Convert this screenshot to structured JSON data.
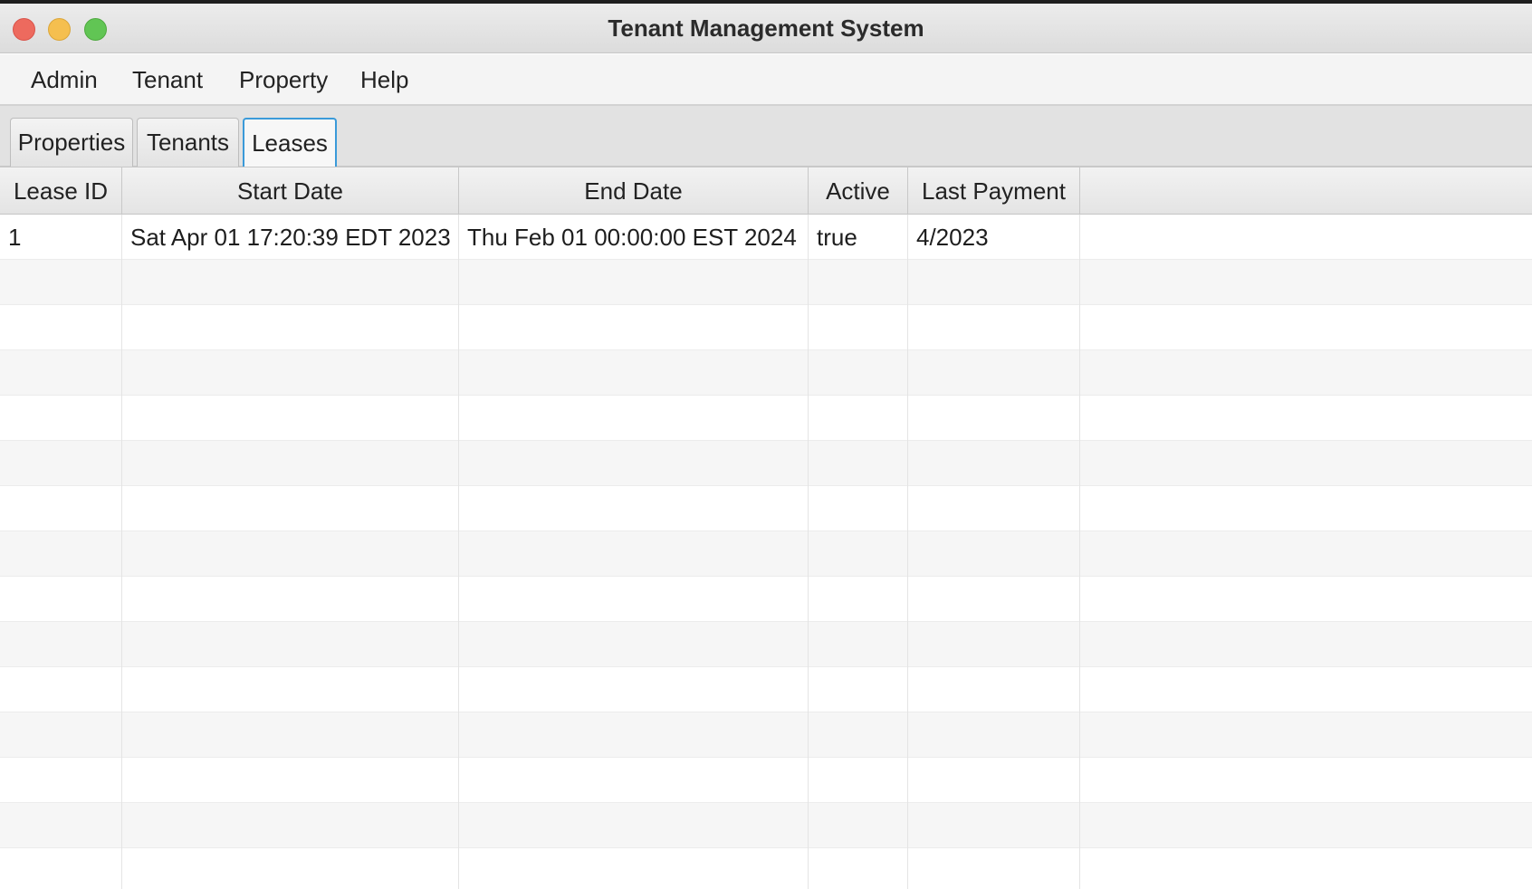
{
  "window": {
    "title": "Tenant Management System"
  },
  "menubar": {
    "items": [
      {
        "label": "Admin"
      },
      {
        "label": "Tenant"
      },
      {
        "label": "Property"
      },
      {
        "label": "Help"
      }
    ]
  },
  "tabs": [
    {
      "label": "Properties",
      "selected": false
    },
    {
      "label": "Tenants",
      "selected": false
    },
    {
      "label": "Leases",
      "selected": true
    }
  ],
  "table": {
    "columns": [
      "Lease ID",
      "Start Date",
      "End Date",
      "Active",
      "Last Payment"
    ],
    "rows": [
      [
        "1",
        "Sat Apr 01 17:20:39 EDT 2023",
        "Thu Feb 01 00:00:00 EST 2024",
        "true",
        "4/2023"
      ]
    ]
  },
  "colors": {
    "selected_tab_border": "#3a9ad9",
    "close_button": "#ed6a5e",
    "minimize_button": "#f5bf4f",
    "maximize_button": "#61c554"
  }
}
